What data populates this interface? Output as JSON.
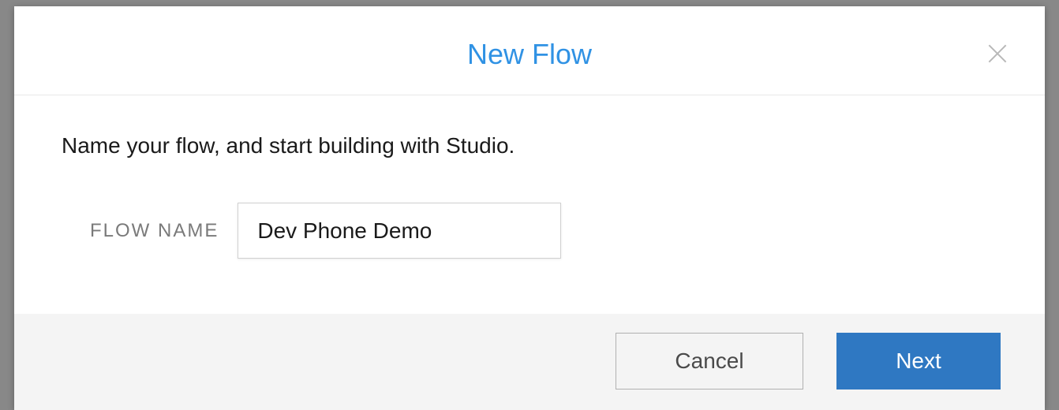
{
  "modal": {
    "title": "New Flow",
    "description": "Name your flow, and start building with Studio.",
    "fields": {
      "flow_name": {
        "label": "FLOW NAME",
        "value": "Dev Phone Demo"
      }
    },
    "actions": {
      "cancel": "Cancel",
      "next": "Next"
    }
  }
}
